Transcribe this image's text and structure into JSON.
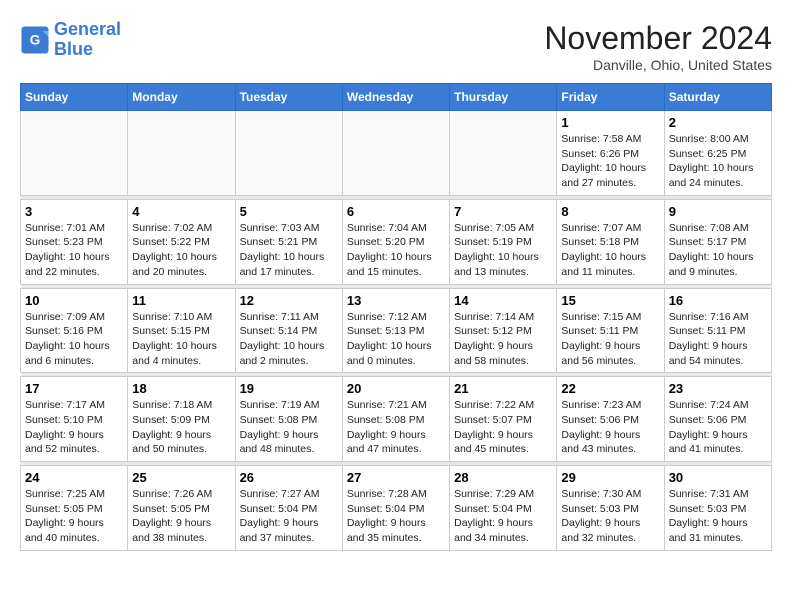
{
  "header": {
    "logo_line1": "General",
    "logo_line2": "Blue",
    "month": "November 2024",
    "location": "Danville, Ohio, United States"
  },
  "weekdays": [
    "Sunday",
    "Monday",
    "Tuesday",
    "Wednesday",
    "Thursday",
    "Friday",
    "Saturday"
  ],
  "weeks": [
    [
      {
        "day": "",
        "info": ""
      },
      {
        "day": "",
        "info": ""
      },
      {
        "day": "",
        "info": ""
      },
      {
        "day": "",
        "info": ""
      },
      {
        "day": "",
        "info": ""
      },
      {
        "day": "1",
        "info": "Sunrise: 7:58 AM\nSunset: 6:26 PM\nDaylight: 10 hours and 27 minutes."
      },
      {
        "day": "2",
        "info": "Sunrise: 8:00 AM\nSunset: 6:25 PM\nDaylight: 10 hours and 24 minutes."
      }
    ],
    [
      {
        "day": "3",
        "info": "Sunrise: 7:01 AM\nSunset: 5:23 PM\nDaylight: 10 hours and 22 minutes."
      },
      {
        "day": "4",
        "info": "Sunrise: 7:02 AM\nSunset: 5:22 PM\nDaylight: 10 hours and 20 minutes."
      },
      {
        "day": "5",
        "info": "Sunrise: 7:03 AM\nSunset: 5:21 PM\nDaylight: 10 hours and 17 minutes."
      },
      {
        "day": "6",
        "info": "Sunrise: 7:04 AM\nSunset: 5:20 PM\nDaylight: 10 hours and 15 minutes."
      },
      {
        "day": "7",
        "info": "Sunrise: 7:05 AM\nSunset: 5:19 PM\nDaylight: 10 hours and 13 minutes."
      },
      {
        "day": "8",
        "info": "Sunrise: 7:07 AM\nSunset: 5:18 PM\nDaylight: 10 hours and 11 minutes."
      },
      {
        "day": "9",
        "info": "Sunrise: 7:08 AM\nSunset: 5:17 PM\nDaylight: 10 hours and 9 minutes."
      }
    ],
    [
      {
        "day": "10",
        "info": "Sunrise: 7:09 AM\nSunset: 5:16 PM\nDaylight: 10 hours and 6 minutes."
      },
      {
        "day": "11",
        "info": "Sunrise: 7:10 AM\nSunset: 5:15 PM\nDaylight: 10 hours and 4 minutes."
      },
      {
        "day": "12",
        "info": "Sunrise: 7:11 AM\nSunset: 5:14 PM\nDaylight: 10 hours and 2 minutes."
      },
      {
        "day": "13",
        "info": "Sunrise: 7:12 AM\nSunset: 5:13 PM\nDaylight: 10 hours and 0 minutes."
      },
      {
        "day": "14",
        "info": "Sunrise: 7:14 AM\nSunset: 5:12 PM\nDaylight: 9 hours and 58 minutes."
      },
      {
        "day": "15",
        "info": "Sunrise: 7:15 AM\nSunset: 5:11 PM\nDaylight: 9 hours and 56 minutes."
      },
      {
        "day": "16",
        "info": "Sunrise: 7:16 AM\nSunset: 5:11 PM\nDaylight: 9 hours and 54 minutes."
      }
    ],
    [
      {
        "day": "17",
        "info": "Sunrise: 7:17 AM\nSunset: 5:10 PM\nDaylight: 9 hours and 52 minutes."
      },
      {
        "day": "18",
        "info": "Sunrise: 7:18 AM\nSunset: 5:09 PM\nDaylight: 9 hours and 50 minutes."
      },
      {
        "day": "19",
        "info": "Sunrise: 7:19 AM\nSunset: 5:08 PM\nDaylight: 9 hours and 48 minutes."
      },
      {
        "day": "20",
        "info": "Sunrise: 7:21 AM\nSunset: 5:08 PM\nDaylight: 9 hours and 47 minutes."
      },
      {
        "day": "21",
        "info": "Sunrise: 7:22 AM\nSunset: 5:07 PM\nDaylight: 9 hours and 45 minutes."
      },
      {
        "day": "22",
        "info": "Sunrise: 7:23 AM\nSunset: 5:06 PM\nDaylight: 9 hours and 43 minutes."
      },
      {
        "day": "23",
        "info": "Sunrise: 7:24 AM\nSunset: 5:06 PM\nDaylight: 9 hours and 41 minutes."
      }
    ],
    [
      {
        "day": "24",
        "info": "Sunrise: 7:25 AM\nSunset: 5:05 PM\nDaylight: 9 hours and 40 minutes."
      },
      {
        "day": "25",
        "info": "Sunrise: 7:26 AM\nSunset: 5:05 PM\nDaylight: 9 hours and 38 minutes."
      },
      {
        "day": "26",
        "info": "Sunrise: 7:27 AM\nSunset: 5:04 PM\nDaylight: 9 hours and 37 minutes."
      },
      {
        "day": "27",
        "info": "Sunrise: 7:28 AM\nSunset: 5:04 PM\nDaylight: 9 hours and 35 minutes."
      },
      {
        "day": "28",
        "info": "Sunrise: 7:29 AM\nSunset: 5:04 PM\nDaylight: 9 hours and 34 minutes."
      },
      {
        "day": "29",
        "info": "Sunrise: 7:30 AM\nSunset: 5:03 PM\nDaylight: 9 hours and 32 minutes."
      },
      {
        "day": "30",
        "info": "Sunrise: 7:31 AM\nSunset: 5:03 PM\nDaylight: 9 hours and 31 minutes."
      }
    ]
  ]
}
